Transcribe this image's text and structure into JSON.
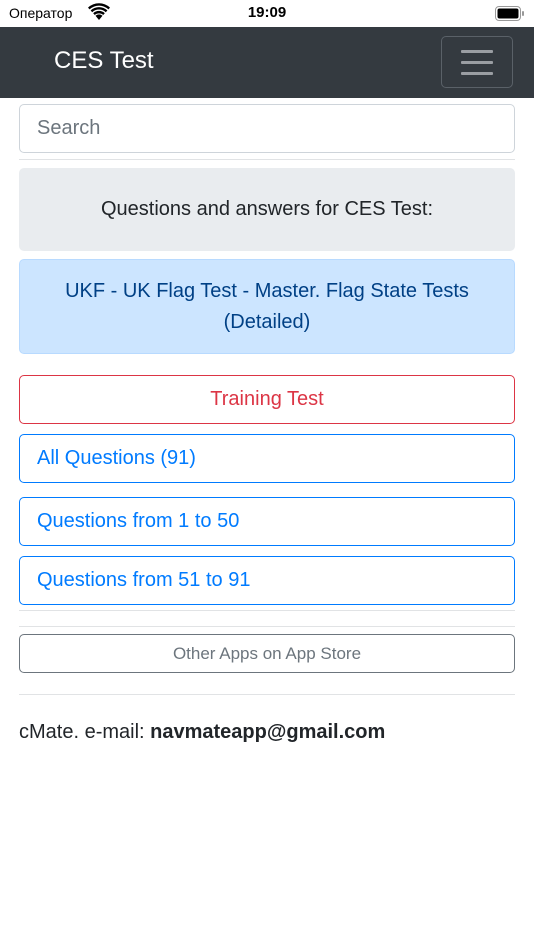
{
  "status_bar": {
    "carrier": "Оператор",
    "time": "19:09"
  },
  "navbar": {
    "brand": "CES Test",
    "menu_icon": "hamburger-menu-icon"
  },
  "search": {
    "placeholder": "Search"
  },
  "header_box": {
    "text": "Questions and answers for CES Test:"
  },
  "info_box": {
    "text": "UKF - UK Flag Test - Master. Flag State Tests (Detailed)"
  },
  "buttons": {
    "training": "Training Test",
    "all_questions": "All Questions (91)",
    "range_1": "Questions from 1 to 50",
    "range_2": "Questions from 51 to 91",
    "other_apps": "Other Apps on App Store"
  },
  "footer": {
    "prefix": "cMate. e-mail: ",
    "email": "navmateapp@gmail.com"
  },
  "colors": {
    "navbar_bg": "#343a40",
    "danger": "#dc3545",
    "primary": "#007bff",
    "secondary": "#6c757d",
    "info_bg": "#cce5ff",
    "light_bg": "#e9ecef"
  }
}
